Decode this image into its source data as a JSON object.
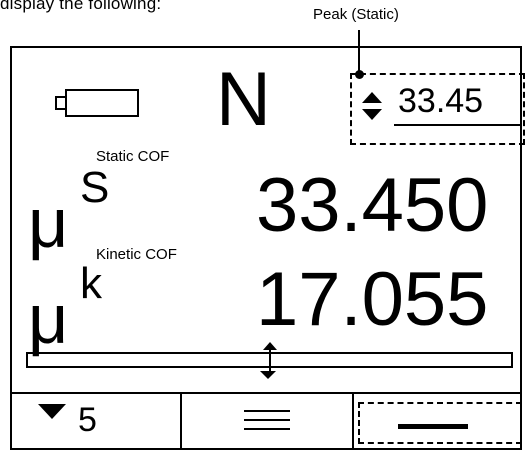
{
  "intro_text": "display the following:",
  "callout": {
    "label": "Peak (Static)"
  },
  "display": {
    "unit": "N",
    "peak_value": "33.45",
    "static": {
      "label": "Static COF",
      "symbol": "μ",
      "superscript": "S",
      "value": "33.450"
    },
    "kinetic": {
      "label": "Kinetic COF",
      "symbol": "μ",
      "superscript": "k",
      "value": "17.055"
    },
    "load_bar_level": 0.5
  },
  "footer": {
    "count": "5"
  },
  "icons": [
    "battery-icon",
    "up-down-arrows-icon",
    "down-triangle-icon",
    "menu-lines-icon",
    "dash-icon",
    "marker-arrow-up-icon",
    "marker-arrow-down-icon"
  ]
}
